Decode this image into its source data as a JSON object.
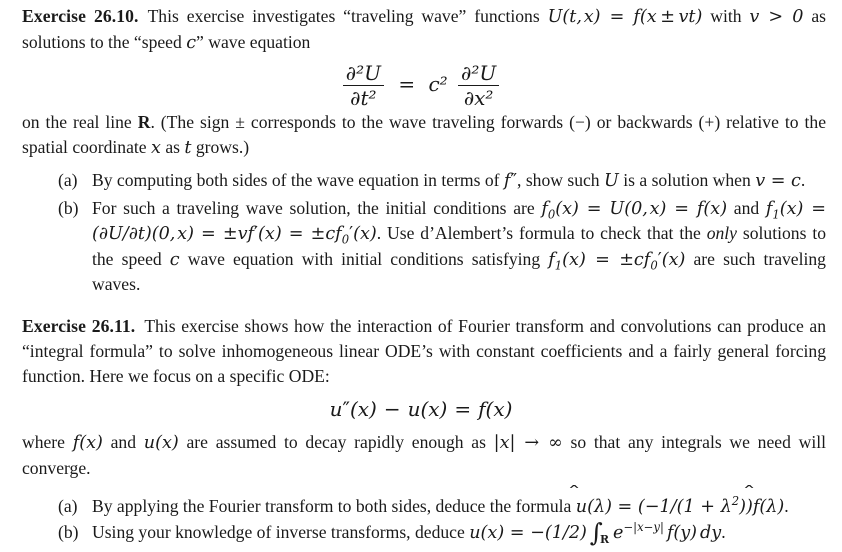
{
  "document": {
    "background_color": "#ffffff",
    "text_color": "#1a1a1a"
  },
  "exercises": [
    {
      "id": "26.10",
      "label": "Exercise 26.10.",
      "intro_line1": "This exercise investigates “traveling wave” functions",
      "intro_math1": "U(t, x) = f(x ± vt)",
      "intro_mid": "with",
      "intro_math2": "v > 0",
      "intro_line2": "as solutions to the “speed",
      "intro_math3": "c",
      "intro_line3": "” wave equation",
      "display_equation": {
        "lhs_num": "∂²U",
        "lhs_den": "∂t²",
        "operator": "=",
        "coefficient": "c²",
        "rhs_num": "∂²U",
        "rhs_den": "∂x²",
        "plain": "∂²U/∂t² = c² ∂²U/∂x²"
      },
      "after_equation": "on the real line R. (The sign ± corresponds to the wave traveling forwards (−) or backwards (+) relative to the spatial coordinate x as t grows.)",
      "items": [
        {
          "marker": "(a)",
          "text": "By computing both sides of the wave equation in terms of f″, show such U is a solution when v = c.",
          "plain": "By computing both sides of the wave equation in terms of f'', show such U is a solution when v = c."
        },
        {
          "marker": "(b)",
          "text": "For such a traveling wave solution, the initial conditions are f₀(x) = U(0, x) = f(x) and f₁(x) = (∂U/∂t)(0, x) = ±vf′(x) = ±cf₀′(x). Use d’Alembert’s formula to check that the only solutions to the speed c wave equation with initial conditions satisfying f₁(x) = ±cf₀′(x) are such traveling waves.",
          "plain": "For such a traveling wave solution, the initial conditions are f_0(x) = U(0,x) = f(x) and f_1(x) = (dU/dt)(0,x) = ±v f'(x) = ±c f_0'(x). Use d'Alembert's formula to check that the only solutions to the speed c wave equation with initial conditions satisfying f_1(x) = ±c f_0'(x) are such traveling waves."
        }
      ]
    },
    {
      "id": "26.11",
      "label": "Exercise 26.11.",
      "intro": "This exercise shows how the interaction of Fourier transform and convolutions can produce an “integral formula” to solve inhomogeneous linear ODE’s with constant coefficients and a fairly general forcing function. Here we focus on a specific ODE:",
      "display_equation": {
        "plain": "u″(x) − u(x) = f(x)"
      },
      "after_equation": "where f(x) and u(x) are assumed to decay rapidly enough as |x| → ∞ so that any integrals we need will converge.",
      "items": [
        {
          "marker": "(a)",
          "text": "By applying the Fourier transform to both sides, deduce the formula û(λ) = (−1/(1 + λ²))f̂(λ).",
          "plain": "By applying the Fourier transform to both sides, deduce the formula u-hat(lambda) = (-1/(1+lambda^2)) f-hat(lambda)."
        },
        {
          "marker": "(b)",
          "text": "Using your knowledge of inverse transforms, deduce u(x) = −(1/2) ∫_R e^(−|x−y|) f(y) dy.",
          "plain": "Using your knowledge of inverse transforms, deduce u(x) = -(1/2) ∫_R e^{-|x-y|} f(y) dy."
        }
      ]
    }
  ],
  "symbols": {
    "partial": "∂",
    "integral": "∫",
    "plus_minus": "±",
    "minus": "−",
    "lambda": "λ",
    "infinity": "∞",
    "arrow_right": "→",
    "hat": "̂",
    "real_line": "R",
    "equals": "=",
    "prime": "′",
    "double_prime": "″"
  }
}
